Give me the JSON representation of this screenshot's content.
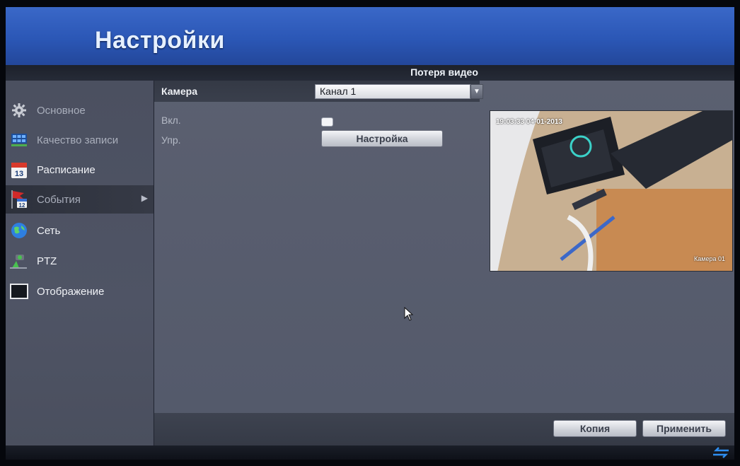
{
  "header": {
    "title": "Настройки"
  },
  "section": {
    "title": "Потеря видео"
  },
  "sidebar": {
    "items": [
      {
        "label": "Основное",
        "icon": "gear-icon",
        "active": false
      },
      {
        "label": "Качество записи",
        "icon": "record-quality-icon",
        "active": false
      },
      {
        "label": "Расписание",
        "icon": "calendar-icon",
        "active": false
      },
      {
        "label": "События",
        "icon": "events-icon",
        "active": true
      },
      {
        "label": "Сеть",
        "icon": "network-globe-icon",
        "active": false
      },
      {
        "label": "PTZ",
        "icon": "ptz-camera-icon",
        "active": false
      },
      {
        "label": "Отображение",
        "icon": "monitor-icon",
        "active": false
      }
    ]
  },
  "form": {
    "camera_label": "Камера",
    "camera_value": "Канал 1",
    "enable_label": "Вкл.",
    "handle_label": "Упр.",
    "settings_button": "Настройка"
  },
  "preview": {
    "osd_time": "19:03:33 04-01-2013",
    "osd_name": "Камера 01"
  },
  "footer": {
    "copy_button": "Копия",
    "apply_button": "Применить"
  },
  "colors": {
    "header_blue": "#2b57b6",
    "panel_gray": "#585d6e",
    "sidebar_gray": "#4f5465"
  }
}
